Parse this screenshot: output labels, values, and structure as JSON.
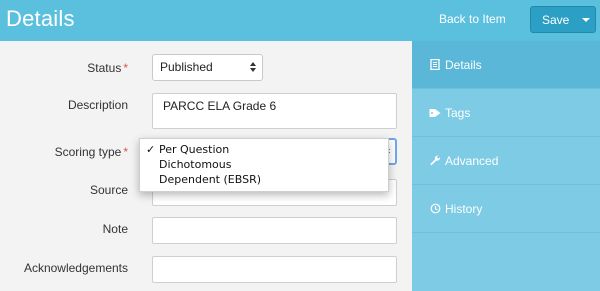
{
  "header": {
    "title": "Details",
    "back_link": "Back to Item",
    "save_label": "Save"
  },
  "form": {
    "status": {
      "label": "Status",
      "required_mark": "*",
      "value": "Published"
    },
    "description": {
      "label": "Description",
      "value": "PARCC ELA Grade 6"
    },
    "scoring_type": {
      "label": "Scoring type",
      "required_mark": "*",
      "options": [
        {
          "label": "Per Question",
          "selected": true
        },
        {
          "label": "Dichotomous",
          "selected": false
        },
        {
          "label": "Dependent (EBSR)",
          "selected": false
        }
      ],
      "check_glyph": "✓"
    },
    "source": {
      "label": "Source",
      "value": ""
    },
    "note": {
      "label": "Note",
      "value": ""
    },
    "acknowledgements": {
      "label": "Acknowledgements",
      "value": ""
    }
  },
  "sidebar": {
    "items": [
      {
        "label": "Details",
        "icon": "document-icon",
        "active": true
      },
      {
        "label": "Tags",
        "icon": "tag-icon",
        "active": false
      },
      {
        "label": "Advanced",
        "icon": "wrench-icon",
        "active": false
      },
      {
        "label": "History",
        "icon": "history-icon",
        "active": false
      }
    ]
  },
  "colors": {
    "header": "#5bc0de",
    "save_button": "#2b9fc4",
    "sidebar": "#7ecbe5",
    "sidebar_active": "#5ab7d8",
    "required": "#d9534f"
  }
}
